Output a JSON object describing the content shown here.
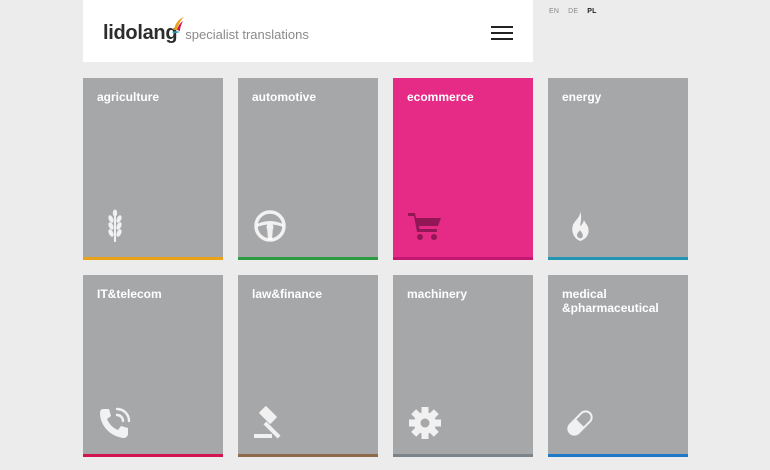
{
  "header": {
    "logo": "lidolang",
    "tagline": "specialist translations"
  },
  "languages": [
    {
      "code": "EN",
      "active": false
    },
    {
      "code": "DE",
      "active": false
    },
    {
      "code": "PL",
      "active": true
    }
  ],
  "tiles": [
    {
      "label": "agriculture",
      "icon": "wheat-icon",
      "bar_color": "#e8a319",
      "bg": "#a6a7a9"
    },
    {
      "label": "automotive",
      "icon": "steering-wheel-icon",
      "bar_color": "#2a9b3e",
      "bg": "#a6a7a9"
    },
    {
      "label": "ecommerce",
      "icon": "shopping-cart-icon",
      "bar_color": "#c21873",
      "bg": "#e52b86"
    },
    {
      "label": "energy",
      "icon": "flame-icon",
      "bar_color": "#2195b3",
      "bg": "#a6a7a9"
    },
    {
      "label": "IT&telecom",
      "icon": "phone-icon",
      "bar_color": "#d1164f",
      "bg": "#a6a7a9"
    },
    {
      "label": "law&finance",
      "icon": "gavel-icon",
      "bar_color": "#8c6a4a",
      "bg": "#a6a7a9"
    },
    {
      "label": "machinery",
      "icon": "gear-icon",
      "bar_color": "#7d8489",
      "bg": "#a6a7a9"
    },
    {
      "label": "medical\n&pharmaceutical",
      "icon": "pill-icon",
      "bar_color": "#1f78c8",
      "bg": "#a6a7a9"
    }
  ]
}
